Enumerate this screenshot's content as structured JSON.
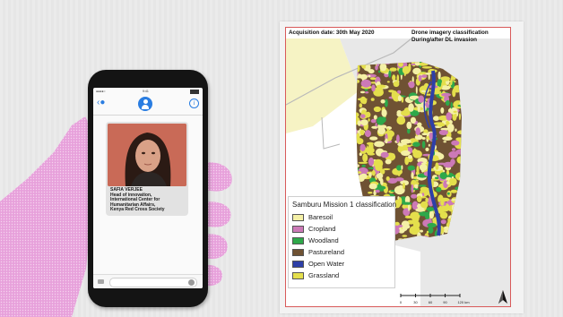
{
  "phone": {
    "status_time": "9:41",
    "caption_lines": [
      "SAFIA VERJEE",
      "Head of innovation,",
      "International Center for",
      "Humanitarian Affairs,",
      "Kenya Red Cross Society"
    ],
    "info_glyph": "i",
    "icons": [
      "back-chevron-icon",
      "contact-avatar-icon",
      "info-icon",
      "camera-icon",
      "send-icon"
    ]
  },
  "map": {
    "acquisition": "Acquisition date: 30th May 2020",
    "title_line1": "Drone imagery classification",
    "title_line2": "During/after DL invasion",
    "legend_title": "Samburu Mission 1 classification",
    "legend": [
      {
        "label": "Baresoil",
        "color": "#f4f0a6"
      },
      {
        "label": "Cropland",
        "color": "#cc79b7"
      },
      {
        "label": "Woodland",
        "color": "#2ea84a"
      },
      {
        "label": "Pastureland",
        "color": "#6f5233"
      },
      {
        "label": "Open Water",
        "color": "#2e3fa8"
      },
      {
        "label": "Grassland",
        "color": "#e4df4c"
      }
    ],
    "scale_ticks": [
      "0",
      "30",
      "60",
      "90",
      "120 km"
    ]
  },
  "colors": {
    "frame_border": "#d85a5a",
    "ios_blue": "#2a7de1",
    "glove": "#e9a0dc"
  }
}
